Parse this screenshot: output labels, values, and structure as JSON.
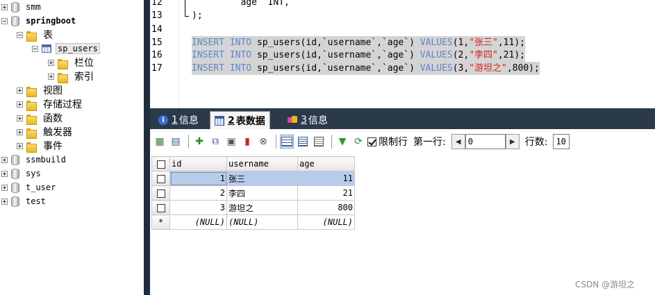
{
  "tree": {
    "items": [
      {
        "label": "smm"
      },
      {
        "label": "springboot"
      },
      {
        "label": "表"
      },
      {
        "label": "sp_users"
      },
      {
        "label": "栏位"
      },
      {
        "label": "索引"
      },
      {
        "label": "视图"
      },
      {
        "label": "存储过程"
      },
      {
        "label": "函数"
      },
      {
        "label": "触发器"
      },
      {
        "label": "事件"
      },
      {
        "label": "ssmbuild"
      },
      {
        "label": "sys"
      },
      {
        "label": "t_user"
      },
      {
        "label": "test"
      }
    ]
  },
  "editor": {
    "line_numbers": [
      "12",
      "13",
      "14",
      "15",
      "16",
      "17"
    ],
    "line12": "        `age` INT,",
    "line13": ");",
    "inserts": [
      {
        "kw1": "INSERT",
        "kw2": "INTO",
        "mid": " sp_users(id,`username`,`age`) ",
        "kw3": "VALUES",
        "pre": "(1,",
        "str": "\"张三\"",
        "post": ",11);"
      },
      {
        "kw1": "INSERT",
        "kw2": "INTO",
        "mid": " sp_users(id,`username`,`age`) ",
        "kw3": "VALUES",
        "pre": "(2,",
        "str": "\"李四\"",
        "post": ",21);"
      },
      {
        "kw1": "INSERT",
        "kw2": "INTO",
        "mid": " sp_users(id,`username`,`age`) ",
        "kw3": "VALUES",
        "pre": "(3,",
        "str": "\"游坦之\"",
        "post": ",800);"
      }
    ]
  },
  "tabs": [
    {
      "num": "1",
      "label": "信息"
    },
    {
      "num": "2",
      "label": "表数据"
    },
    {
      "num": "3",
      "label": "信息"
    }
  ],
  "toolbar": {
    "limit_label": "限制行",
    "first_row_label": "第一行:",
    "first_row_value": "0",
    "rows_label": "行数:",
    "rows_value": "10"
  },
  "grid": {
    "columns": [
      "id",
      "username",
      "age"
    ],
    "rows": [
      {
        "id": "1",
        "username": "张三",
        "age": "11"
      },
      {
        "id": "2",
        "username": "李四",
        "age": "21"
      },
      {
        "id": "3",
        "username": "游坦之",
        "age": "800"
      }
    ],
    "new_row": {
      "marker": "*",
      "id": "(NULL)",
      "username": "(NULL)",
      "age": "(NULL)"
    }
  },
  "watermark": "CSDN @游坦之"
}
